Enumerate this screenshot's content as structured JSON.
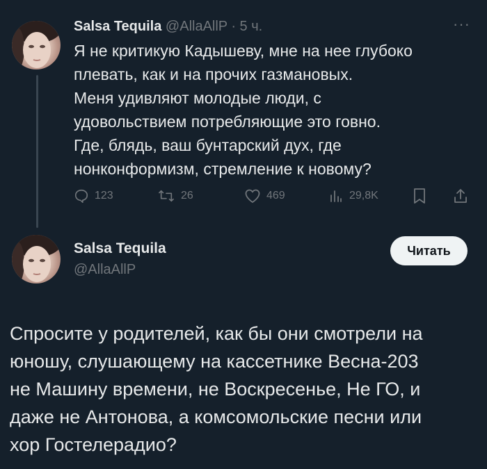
{
  "tweet1": {
    "author_name": "Salsa Tequila",
    "handle_time": "@AllaAllP · 5 ч.",
    "more_icon": "more-dots-icon",
    "text_lines": [
      "Я не критикую Кадышеву, мне на нее глубоко",
      "плевать, как и на прочих газмановых.",
      "Меня удивляют молодые люди, с",
      "удовольствием потребляющие это говно.",
      "Где, блядь, ваш бунтарский дух, где",
      "нонконформизм, стремление к новому?"
    ],
    "replies": "123",
    "retweets": "26",
    "likes": "469",
    "views": "29,8K"
  },
  "tweet2": {
    "author_name": "Salsa Tequila",
    "handle": "@AllaAllP",
    "follow_label": "Читать",
    "text_lines": [
      "Спросите у родителей, как бы они смотрели на",
      "юношу, слушающему на кассетнике Весна-203",
      "не Машину времени, не Воскресенье, Не ГО, и",
      "даже не Антонова, а комсомольские песни или",
      "хор Гостелерадио?"
    ]
  },
  "colors": {
    "background": "#15202b",
    "text": "#e7e9ea",
    "muted": "#71767b",
    "button_bg": "#eff3f4"
  }
}
